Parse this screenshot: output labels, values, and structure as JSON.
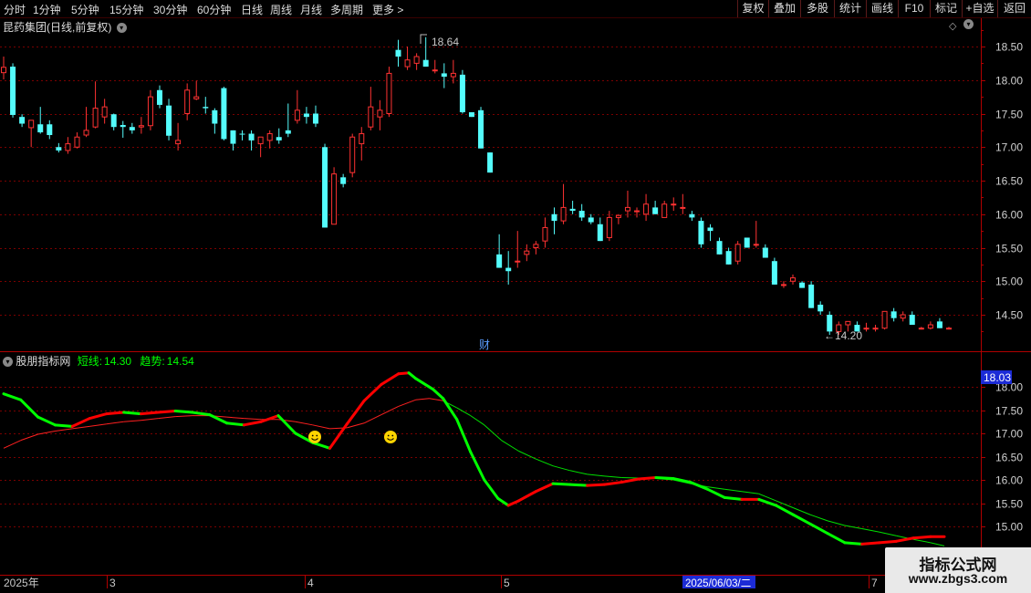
{
  "toolbar": {
    "periods": [
      "分时",
      "1分钟",
      "5分钟",
      "15分钟",
      "30分钟",
      "60分钟",
      "日线",
      "周线",
      "月线",
      "多周期",
      "更多 >"
    ],
    "right_buttons": [
      "复权",
      "叠加",
      "多股",
      "统计",
      "画线",
      "F10",
      "标记",
      "+自选",
      "返回"
    ]
  },
  "main_chart": {
    "title": "昆药集团(日线,前复权)",
    "high_label": "18.64",
    "low_label": "←14.20",
    "finance_marker": "财",
    "y_ticks": [
      "18.50",
      "18.00",
      "17.50",
      "17.00",
      "16.50",
      "16.00",
      "15.50",
      "15.00",
      "14.50"
    ]
  },
  "indicator": {
    "name": "股朋指标网",
    "short_label": "短线:",
    "short_value": "14.30",
    "trend_label": "趋势:",
    "trend_value": "14.54",
    "y_ticks": [
      "18.00",
      "17.50",
      "17.00",
      "16.50",
      "16.00",
      "15.50",
      "15.00"
    ],
    "current_value_box": "18.03"
  },
  "time_axis": {
    "labels": [
      "2025年",
      "3",
      "4",
      "5",
      "2025/06/03/二",
      "7"
    ]
  },
  "watermark": {
    "line1": "指标公式网",
    "line2": "www.zbgs3.com"
  },
  "colors": {
    "up": "#ff3232",
    "down": "#54fcfc",
    "grid": "#7a0000",
    "short_up": "#ff0000",
    "short_down": "#00ff00",
    "trend": "#ff2020",
    "trend_late": "#00e000"
  },
  "candles": [
    [
      18.11,
      18.35,
      18.01,
      18.19
    ],
    [
      18.2,
      18.25,
      17.44,
      17.48
    ],
    [
      17.45,
      17.49,
      17.3,
      17.35
    ],
    [
      17.29,
      17.4,
      17.0,
      17.4
    ],
    [
      17.34,
      17.6,
      17.2,
      17.22
    ],
    [
      17.34,
      17.4,
      17.12,
      17.18
    ],
    [
      17.0,
      17.06,
      16.92,
      16.95
    ],
    [
      16.95,
      17.15,
      16.9,
      17.05
    ],
    [
      17.0,
      17.22,
      16.98,
      17.15
    ],
    [
      17.18,
      17.6,
      17.15,
      17.25
    ],
    [
      17.3,
      17.98,
      17.28,
      17.58
    ],
    [
      17.45,
      17.72,
      17.35,
      17.6
    ],
    [
      17.49,
      17.5,
      17.25,
      17.3
    ],
    [
      17.33,
      17.39,
      17.14,
      17.3
    ],
    [
      17.3,
      17.36,
      17.2,
      17.25
    ],
    [
      17.3,
      17.45,
      17.2,
      17.32
    ],
    [
      17.32,
      17.85,
      17.25,
      17.75
    ],
    [
      17.85,
      17.92,
      17.58,
      17.63
    ],
    [
      17.62,
      17.72,
      17.1,
      17.17
    ],
    [
      17.05,
      17.36,
      16.95,
      17.1
    ],
    [
      17.5,
      17.95,
      17.4,
      17.85
    ],
    [
      17.72,
      17.99,
      17.7,
      17.75
    ],
    [
      17.6,
      17.75,
      17.5,
      17.58
    ],
    [
      17.55,
      17.58,
      17.2,
      17.35
    ],
    [
      17.88,
      17.9,
      17.1,
      17.12
    ],
    [
      17.25,
      17.25,
      16.95,
      17.05
    ],
    [
      17.2,
      17.25,
      17.1,
      17.19
    ],
    [
      17.2,
      17.25,
      16.95,
      17.1
    ],
    [
      17.05,
      17.1,
      16.85,
      17.15
    ],
    [
      17.1,
      17.25,
      16.98,
      17.2
    ],
    [
      17.15,
      17.28,
      17.05,
      17.1
    ],
    [
      17.25,
      17.65,
      17.15,
      17.2
    ],
    [
      17.4,
      17.85,
      17.35,
      17.55
    ],
    [
      17.5,
      17.6,
      17.35,
      17.45
    ],
    [
      17.5,
      17.62,
      17.3,
      17.35
    ],
    [
      17.0,
      17.05,
      15.8,
      15.8
    ],
    [
      15.85,
      16.7,
      15.85,
      16.6
    ],
    [
      16.55,
      16.6,
      16.4,
      16.45
    ],
    [
      16.62,
      17.2,
      16.55,
      17.15
    ],
    [
      17.05,
      17.3,
      16.8,
      17.2
    ],
    [
      17.3,
      17.9,
      17.25,
      17.6
    ],
    [
      17.45,
      17.7,
      17.25,
      17.55
    ],
    [
      17.5,
      18.2,
      17.45,
      18.1
    ],
    [
      18.45,
      18.6,
      18.2,
      18.35
    ],
    [
      18.2,
      18.5,
      18.15,
      18.3
    ],
    [
      18.25,
      18.4,
      18.15,
      18.35
    ],
    [
      18.3,
      18.64,
      18.2,
      18.2
    ],
    [
      18.15,
      18.3,
      18.1,
      18.15
    ],
    [
      18.1,
      18.25,
      17.88,
      18.05
    ],
    [
      18.05,
      18.3,
      17.95,
      18.1
    ],
    [
      18.08,
      18.15,
      17.5,
      17.52
    ],
    [
      17.52,
      17.5,
      17.45,
      17.45
    ],
    [
      17.55,
      17.6,
      16.98,
      16.98
    ],
    [
      16.92,
      16.92,
      16.62,
      16.62
    ],
    [
      15.4,
      15.7,
      15.2,
      15.2
    ],
    [
      15.2,
      15.45,
      14.95,
      15.15
    ],
    [
      15.3,
      15.75,
      15.2,
      15.3
    ],
    [
      15.4,
      15.55,
      15.3,
      15.45
    ],
    [
      15.5,
      15.6,
      15.4,
      15.55
    ],
    [
      15.6,
      15.95,
      15.5,
      15.8
    ],
    [
      16.0,
      16.1,
      15.7,
      15.9
    ],
    [
      15.9,
      16.45,
      15.85,
      16.1
    ],
    [
      16.08,
      16.2,
      16.0,
      16.05
    ],
    [
      16.05,
      16.15,
      15.9,
      15.95
    ],
    [
      15.95,
      16.0,
      15.85,
      15.88
    ],
    [
      15.85,
      15.95,
      15.6,
      15.6
    ],
    [
      15.65,
      16.05,
      15.6,
      15.95
    ],
    [
      15.95,
      16.0,
      15.85,
      15.98
    ],
    [
      16.05,
      16.35,
      15.95,
      16.1
    ],
    [
      16.05,
      16.1,
      15.95,
      16.05
    ],
    [
      16.0,
      16.3,
      15.9,
      16.15
    ],
    [
      16.1,
      16.2,
      16.0,
      16.0
    ],
    [
      15.95,
      16.2,
      15.95,
      16.15
    ],
    [
      16.15,
      16.25,
      16.05,
      16.15
    ],
    [
      16.1,
      16.3,
      16.0,
      16.1
    ],
    [
      16.0,
      16.05,
      15.9,
      15.95
    ],
    [
      15.9,
      15.95,
      15.5,
      15.55
    ],
    [
      15.8,
      15.85,
      15.6,
      15.75
    ],
    [
      15.6,
      15.65,
      15.4,
      15.4
    ],
    [
      15.45,
      15.5,
      15.25,
      15.25
    ],
    [
      15.3,
      15.6,
      15.25,
      15.55
    ],
    [
      15.65,
      15.65,
      15.5,
      15.5
    ],
    [
      15.55,
      15.9,
      15.5,
      15.55
    ],
    [
      15.5,
      15.55,
      15.35,
      15.35
    ],
    [
      15.3,
      15.35,
      14.95,
      14.95
    ],
    [
      14.95,
      15.0,
      14.9,
      14.95
    ],
    [
      15.0,
      15.1,
      14.95,
      15.05
    ],
    [
      14.98,
      15.0,
      14.9,
      14.9
    ],
    [
      14.95,
      15.0,
      14.6,
      14.6
    ],
    [
      14.65,
      14.7,
      14.5,
      14.55
    ],
    [
      14.5,
      14.55,
      14.2,
      14.25
    ],
    [
      14.25,
      14.4,
      14.2,
      14.35
    ],
    [
      14.35,
      14.4,
      14.25,
      14.4
    ],
    [
      14.35,
      14.4,
      14.25,
      14.25
    ],
    [
      14.3,
      14.38,
      14.25,
      14.3
    ],
    [
      14.3,
      14.35,
      14.25,
      14.3
    ],
    [
      14.3,
      14.55,
      14.28,
      14.55
    ],
    [
      14.55,
      14.6,
      14.4,
      14.45
    ],
    [
      14.45,
      14.55,
      14.4,
      14.5
    ],
    [
      14.5,
      14.55,
      14.35,
      14.35
    ],
    [
      14.3,
      14.32,
      14.28,
      14.3
    ],
    [
      14.3,
      14.4,
      14.28,
      14.35
    ],
    [
      14.4,
      14.45,
      14.3,
      14.3
    ],
    [
      14.3,
      14.32,
      14.28,
      14.3
    ]
  ],
  "short_line": [
    [
      0,
      17.85
    ],
    [
      5,
      17.72
    ],
    [
      10,
      17.35
    ],
    [
      15,
      17.18
    ],
    [
      20,
      17.15
    ],
    [
      25,
      17.32
    ],
    [
      30,
      17.42
    ],
    [
      35,
      17.45
    ],
    [
      40,
      17.42
    ],
    [
      45,
      17.45
    ],
    [
      50,
      17.48
    ],
    [
      55,
      17.45
    ],
    [
      60,
      17.4
    ],
    [
      65,
      17.22
    ],
    [
      70,
      17.18
    ],
    [
      75,
      17.25
    ],
    [
      80,
      17.38
    ],
    [
      85,
      17.0
    ],
    [
      90,
      16.8
    ],
    [
      95,
      16.68
    ],
    [
      100,
      17.2
    ],
    [
      105,
      17.7
    ],
    [
      110,
      18.05
    ],
    [
      115,
      18.28
    ],
    [
      118,
      18.3
    ],
    [
      120,
      18.18
    ],
    [
      125,
      17.95
    ],
    [
      128,
      17.75
    ],
    [
      132,
      17.3
    ],
    [
      136,
      16.6
    ],
    [
      140,
      16.0
    ],
    [
      144,
      15.6
    ],
    [
      147,
      15.45
    ],
    [
      150,
      15.55
    ],
    [
      155,
      15.75
    ],
    [
      160,
      15.92
    ],
    [
      165,
      15.9
    ],
    [
      170,
      15.88
    ],
    [
      175,
      15.9
    ],
    [
      180,
      15.95
    ],
    [
      185,
      16.02
    ],
    [
      190,
      16.05
    ],
    [
      195,
      16.03
    ],
    [
      200,
      15.95
    ],
    [
      205,
      15.8
    ],
    [
      210,
      15.62
    ],
    [
      215,
      15.58
    ],
    [
      220,
      15.58
    ],
    [
      225,
      15.45
    ],
    [
      230,
      15.25
    ],
    [
      235,
      15.05
    ],
    [
      240,
      14.85
    ],
    [
      245,
      14.65
    ],
    [
      250,
      14.62
    ],
    [
      255,
      14.65
    ],
    [
      260,
      14.68
    ],
    [
      265,
      14.75
    ],
    [
      270,
      14.78
    ],
    [
      274,
      14.78
    ]
  ],
  "trend_line": [
    [
      0,
      16.68
    ],
    [
      5,
      16.85
    ],
    [
      10,
      16.98
    ],
    [
      15,
      17.05
    ],
    [
      20,
      17.1
    ],
    [
      25,
      17.15
    ],
    [
      30,
      17.2
    ],
    [
      35,
      17.25
    ],
    [
      40,
      17.28
    ],
    [
      45,
      17.32
    ],
    [
      50,
      17.36
    ],
    [
      55,
      17.38
    ],
    [
      60,
      17.38
    ],
    [
      65,
      17.35
    ],
    [
      70,
      17.32
    ],
    [
      75,
      17.3
    ],
    [
      80,
      17.3
    ],
    [
      85,
      17.25
    ],
    [
      90,
      17.18
    ],
    [
      95,
      17.1
    ],
    [
      100,
      17.12
    ],
    [
      105,
      17.22
    ],
    [
      110,
      17.4
    ],
    [
      115,
      17.58
    ],
    [
      120,
      17.72
    ],
    [
      124,
      17.75
    ],
    [
      128,
      17.7
    ],
    [
      132,
      17.55
    ],
    [
      136,
      17.38
    ],
    [
      140,
      17.18
    ],
    [
      145,
      16.85
    ],
    [
      150,
      16.62
    ],
    [
      155,
      16.45
    ],
    [
      160,
      16.3
    ],
    [
      165,
      16.2
    ],
    [
      170,
      16.12
    ],
    [
      175,
      16.08
    ],
    [
      180,
      16.05
    ],
    [
      185,
      16.04
    ],
    [
      190,
      16.03
    ],
    [
      195,
      16.0
    ],
    [
      200,
      15.92
    ],
    [
      205,
      15.85
    ],
    [
      210,
      15.8
    ],
    [
      215,
      15.75
    ],
    [
      220,
      15.7
    ],
    [
      225,
      15.55
    ],
    [
      230,
      15.4
    ],
    [
      235,
      15.25
    ],
    [
      240,
      15.12
    ],
    [
      245,
      15.02
    ],
    [
      250,
      14.95
    ],
    [
      255,
      14.88
    ],
    [
      260,
      14.8
    ],
    [
      265,
      14.72
    ],
    [
      270,
      14.65
    ],
    [
      274,
      14.58
    ]
  ]
}
